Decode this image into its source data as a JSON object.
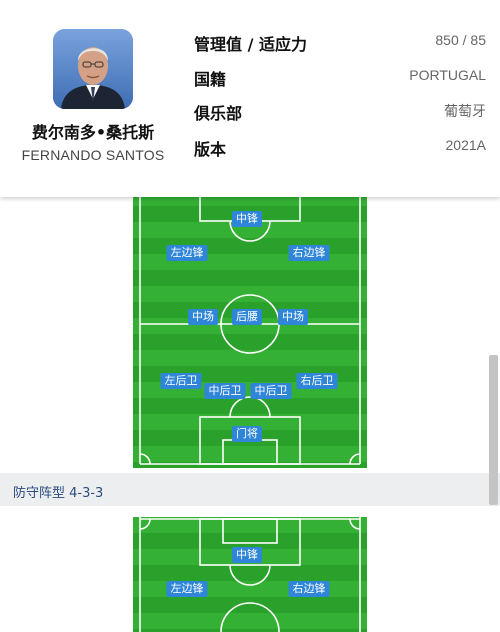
{
  "coach": {
    "name_cn": "费尔南多•桑托斯",
    "name_en": "FERNANDO SANTOS"
  },
  "info": [
    {
      "label": "管理值 / 适应力",
      "value": "850 / 85"
    },
    {
      "label": "国籍",
      "value": "PORTUGAL"
    },
    {
      "label": "俱乐部",
      "value": "葡萄牙"
    },
    {
      "label": "版本",
      "value": "2021A"
    }
  ],
  "formation1": {
    "positions": {
      "cf": "中锋",
      "lw": "左边锋",
      "rw": "右边锋",
      "lcm": "中场",
      "dmf": "后腰",
      "rcm": "中场",
      "lb": "左后卫",
      "lcb": "中后卫",
      "rcb": "中后卫",
      "rb": "右后卫",
      "gk": "门将"
    }
  },
  "section": {
    "title": "防守阵型 4-3-3"
  },
  "formation2": {
    "positions": {
      "cf": "中锋",
      "lw": "左边锋",
      "rw": "右边锋"
    }
  },
  "colors": {
    "accent": "#2f86d8",
    "pitch_light": "#34b034",
    "pitch_dark": "#2aa12b",
    "section_text": "#2b4c7e"
  }
}
